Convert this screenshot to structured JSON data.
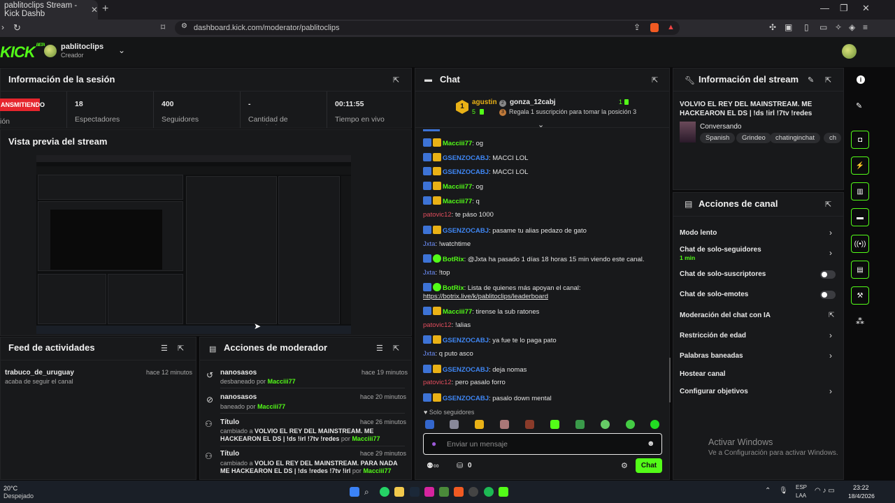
{
  "browser": {
    "tab_title": "pablitoclips Stream - Kick Dashb",
    "url": "dashboard.kick.com/moderator/pablitoclips"
  },
  "header": {
    "logo": "KICK",
    "logo_beta": "BETA",
    "username": "pablitoclips",
    "role": "Creador"
  },
  "session": {
    "title": "Información de la sesión",
    "live_badge": "ANSMITIENDO",
    "live_caption": "ión",
    "stats": [
      {
        "value": "18",
        "label": "Espectadores"
      },
      {
        "value": "400",
        "label": "Seguidores"
      },
      {
        "value": "-",
        "label": "Cantidad de suscripciones"
      },
      {
        "value": "00:11:55",
        "label": "Tiempo en vivo"
      }
    ]
  },
  "preview": {
    "title": "Vista previa del stream"
  },
  "feed": {
    "title": "Feed de actividades",
    "items": [
      {
        "user": "trabuco_de_uruguay",
        "text": "acaba de seguir el canal",
        "time": "hace 12 minutos"
      }
    ]
  },
  "modactions": {
    "title": "Acciones de moderador",
    "items": [
      {
        "title": "nanosasos",
        "text": "desbaneado por",
        "by": "Macciii77",
        "time": "hace 19 minutos"
      },
      {
        "title": "nanosasos",
        "text": "baneado por",
        "by": "Macciii77",
        "time": "hace 20 minutos"
      },
      {
        "title": "Título",
        "text": "cambiado a",
        "value": "VOLVIO EL REY DEL MAINSTREAM. ME HACKEARON EL DS | !ds !irl !7tv !redes",
        "by_pre": "por",
        "by": "Macciii77",
        "time": "hace 26 minutos"
      },
      {
        "title": "Título",
        "text": "cambiado a",
        "value": "VOLIO EL REY DEL MAINSTREAM. PARA NADA ME HACKEARON EL DS | !ds !redes !7tv !irl",
        "by_pre": "por",
        "by": "Macciii77",
        "time": "hace 29 minutos"
      }
    ]
  },
  "chat": {
    "title": "Chat",
    "leader1": {
      "name": "agustin",
      "count": "5"
    },
    "leader2": {
      "name": "gonza_12cabj",
      "count": "1"
    },
    "leader3": {
      "position": "3",
      "text": "Regala 1 suscripción para tomar la posición 3"
    },
    "messages": [
      {
        "user": "Macciii77",
        "color": "green",
        "text": ": og"
      },
      {
        "user": "GSENZOCABJ",
        "color": "blue",
        "text": ": MACCI LOL"
      },
      {
        "user": "GSENZOCABJ",
        "color": "blue",
        "text": ": MACCI LOL"
      },
      {
        "user": "Macciii77",
        "color": "green",
        "text": ": og"
      },
      {
        "user": "Macciii77",
        "color": "green",
        "text": ": q"
      },
      {
        "user": "patovic12",
        "color": "red",
        "text": ": te páso 1000"
      },
      {
        "user": "GSENZOCABJ",
        "color": "blue",
        "text": ": pasame tu alias pedazo de gato"
      },
      {
        "user": "Jxta",
        "color": "dblue",
        "text": ": !watchtime"
      },
      {
        "user": "BotRix",
        "color": "green",
        "text": ": @Jxta ha pasado 1 días 18 horas 15 min viendo este canal."
      },
      {
        "user": "Jxta",
        "color": "dblue",
        "text": ": !top"
      },
      {
        "user": "BotRix",
        "color": "green",
        "text": ": Lista de quienes más apoyan el canal:"
      },
      {
        "user": "Macciii77",
        "color": "green",
        "text": ": tirense la sub ratones"
      },
      {
        "user": "patovic12",
        "color": "red",
        "text": ": !alias"
      },
      {
        "user": "GSENZOCABJ",
        "color": "blue",
        "text": ": ya fue te lo paga pato"
      },
      {
        "user": "Jxta",
        "color": "dblue",
        "text": ": q puto asco"
      },
      {
        "user": "GSENZOCABJ",
        "color": "blue",
        "text": ": deja nomas"
      },
      {
        "user": "patovic12",
        "color": "red",
        "text": ": pero pasalo forro"
      },
      {
        "user": "GSENZOCABJ",
        "color": "blue",
        "text": ": pasalo down mental"
      }
    ],
    "link": "https://botrix.live/k/pablitoclips/leaderboard",
    "followers_only": "Solo seguidores",
    "input_placeholder": "Enviar un mensaje",
    "points": "0",
    "send": "Chat"
  },
  "stream_info": {
    "title": "Información del stream",
    "stream_title": "VOLVIO EL REY DEL MAINSTREAM. ME HACKEARON EL DS | !ds !irl !7tv !redes",
    "category": "Conversando",
    "tags": [
      "Spanish",
      "Grindeo",
      "chatinginchat",
      "ch"
    ]
  },
  "channel_actions": {
    "title": "Acciones de canal",
    "items": [
      {
        "label": "Modo lento"
      },
      {
        "label": "Chat de solo-seguidores",
        "sub": "1 min"
      },
      {
        "label": "Chat de solo-suscriptores"
      },
      {
        "label": "Chat de solo-emotes"
      },
      {
        "label": "Moderación del chat con IA"
      },
      {
        "label": "Restricción de edad"
      },
      {
        "label": "Palabras baneadas"
      },
      {
        "label": "Hostear canal"
      },
      {
        "label": "Configurar objetivos"
      }
    ]
  },
  "watermark": {
    "line1": "Activar Windows",
    "line2": "Ve a Configuración para activar Windows."
  },
  "taskbar": {
    "temp": "20°C",
    "weather": "Despejado",
    "lang1": "ESP",
    "lang2": "LAA",
    "time": "23:22",
    "date": "18/4/2026"
  }
}
